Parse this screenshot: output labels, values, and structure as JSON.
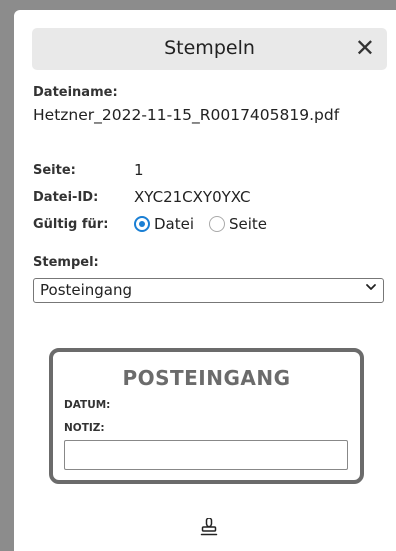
{
  "header": {
    "title": "Stempeln",
    "close_label": "✕"
  },
  "file": {
    "name_label": "Dateiname:",
    "name_value": "Hetzner_2022-11-15_R0017405819.pdf",
    "page_label": "Seite:",
    "page_value": "1",
    "id_label": "Datei-ID:",
    "id_value": "XYC21CXY0YXC",
    "valid_label": "Gültig für:",
    "valid_options": [
      {
        "label": "Datei",
        "selected": true
      },
      {
        "label": "Seite",
        "selected": false
      }
    ]
  },
  "stamp_select": {
    "label": "Stempel:",
    "value": "Posteingang",
    "chevron_icon": "chevron-down-icon"
  },
  "stamp_preview": {
    "title": "POSTEINGANG",
    "datum_label": "DATUM:",
    "notiz_label": "NOTIZ:",
    "notiz_value": ""
  },
  "apply": {
    "icon": "stamp-icon"
  },
  "colors": {
    "accent": "#1a7fd4",
    "stamp_border": "#6b6b6b",
    "header_bg": "#e9e9e9"
  }
}
